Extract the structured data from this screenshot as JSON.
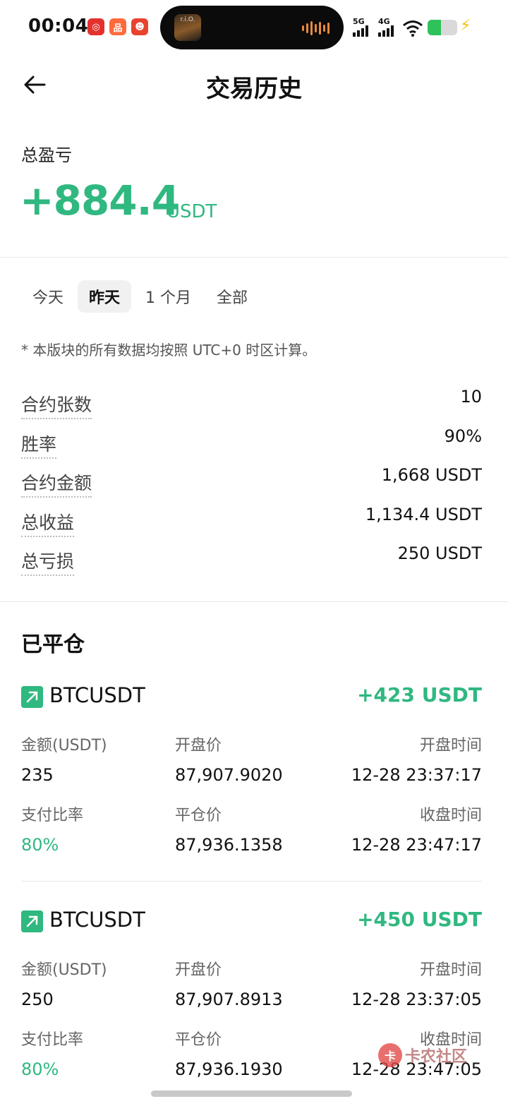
{
  "status_bar": {
    "time": "00:04",
    "apps": [
      {
        "icon": "netease-music-icon",
        "color": "#e3312e",
        "glyph": "◎"
      },
      {
        "icon": "app-grid-icon",
        "color": "#ff6a3d",
        "glyph": "品"
      },
      {
        "icon": "mascot-app-icon",
        "color": "#e8432e",
        "glyph": "☻"
      }
    ],
    "island_thumb_text": "r.i.O.",
    "network_5g": "5G",
    "network_4g": "4G",
    "battery_percent": 45
  },
  "header": {
    "title": "交易历史"
  },
  "summary": {
    "label": "总盈亏",
    "value": "+884.4",
    "unit": "USDT"
  },
  "tabs": [
    {
      "label": "今天",
      "active": false
    },
    {
      "label": "昨天",
      "active": true
    },
    {
      "label": "1 个月",
      "active": false
    },
    {
      "label": "全部",
      "active": false
    }
  ],
  "note": "* 本版块的所有数据均按照 UTC+0 时区计算。",
  "stats": [
    {
      "label": "合约张数",
      "value": "10"
    },
    {
      "label": "胜率",
      "value": "90%"
    },
    {
      "label": "合约金额",
      "value": "1,668 USDT"
    },
    {
      "label": "总收益",
      "value": "1,134.4 USDT"
    },
    {
      "label": "总亏损",
      "value": "250 USDT"
    }
  ],
  "closed_section_title": "已平仓",
  "positions": [
    {
      "symbol": "BTCUSDT",
      "pnl": "+423 USDT",
      "amount_label": "金额(USDT)",
      "amount": "235",
      "open_price_label": "开盘价",
      "open_price": "87,907.9020",
      "open_time_label": "开盘时间",
      "open_time": "12-28 23:37:17",
      "payout_label": "支付比率",
      "payout": "80%",
      "close_price_label": "平仓价",
      "close_price": "87,936.1358",
      "close_time_label": "收盘时间",
      "close_time": "12-28 23:47:17"
    },
    {
      "symbol": "BTCUSDT",
      "pnl": "+450 USDT",
      "amount_label": "金额(USDT)",
      "amount": "250",
      "open_price_label": "开盘价",
      "open_price": "87,907.8913",
      "open_time_label": "开盘时间",
      "open_time": "12-28 23:37:05",
      "payout_label": "支付比率",
      "payout": "80%",
      "close_price_label": "平仓价",
      "close_price": "87,936.1930",
      "close_time_label": "收盘时间",
      "close_time": "12-28 23:47:05"
    }
  ],
  "watermark": {
    "text": "卡农社区",
    "logo": "卡"
  },
  "colors": {
    "positive": "#2fb880",
    "text": "#111111",
    "muted": "#666666"
  }
}
